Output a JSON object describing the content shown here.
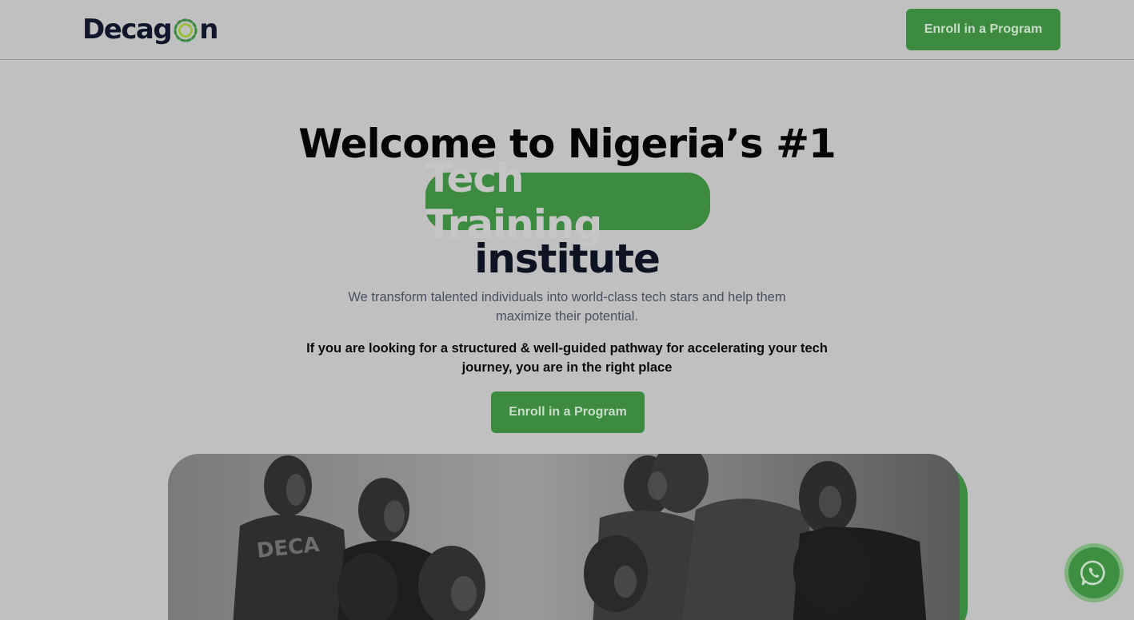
{
  "header": {
    "logo_text_start": "Decag",
    "logo_text_end": "n",
    "enroll_label": "Enroll in a Program"
  },
  "hero": {
    "line1": "Welcome to Nigeria’s #1",
    "highlight": "Tech Training",
    "line3": "institute",
    "subtitle": "We transform talented individuals into world-class tech stars and help them maximize their potential.",
    "tagline": "If you are looking for a structured & well-guided pathway for accelerating your tech journey, you are in the right place",
    "enroll_label": "Enroll in a Program"
  },
  "colors": {
    "brand_green": "#3d8b40",
    "background": "#c0c0c0"
  },
  "icons": {
    "whatsapp": "whatsapp-icon"
  }
}
